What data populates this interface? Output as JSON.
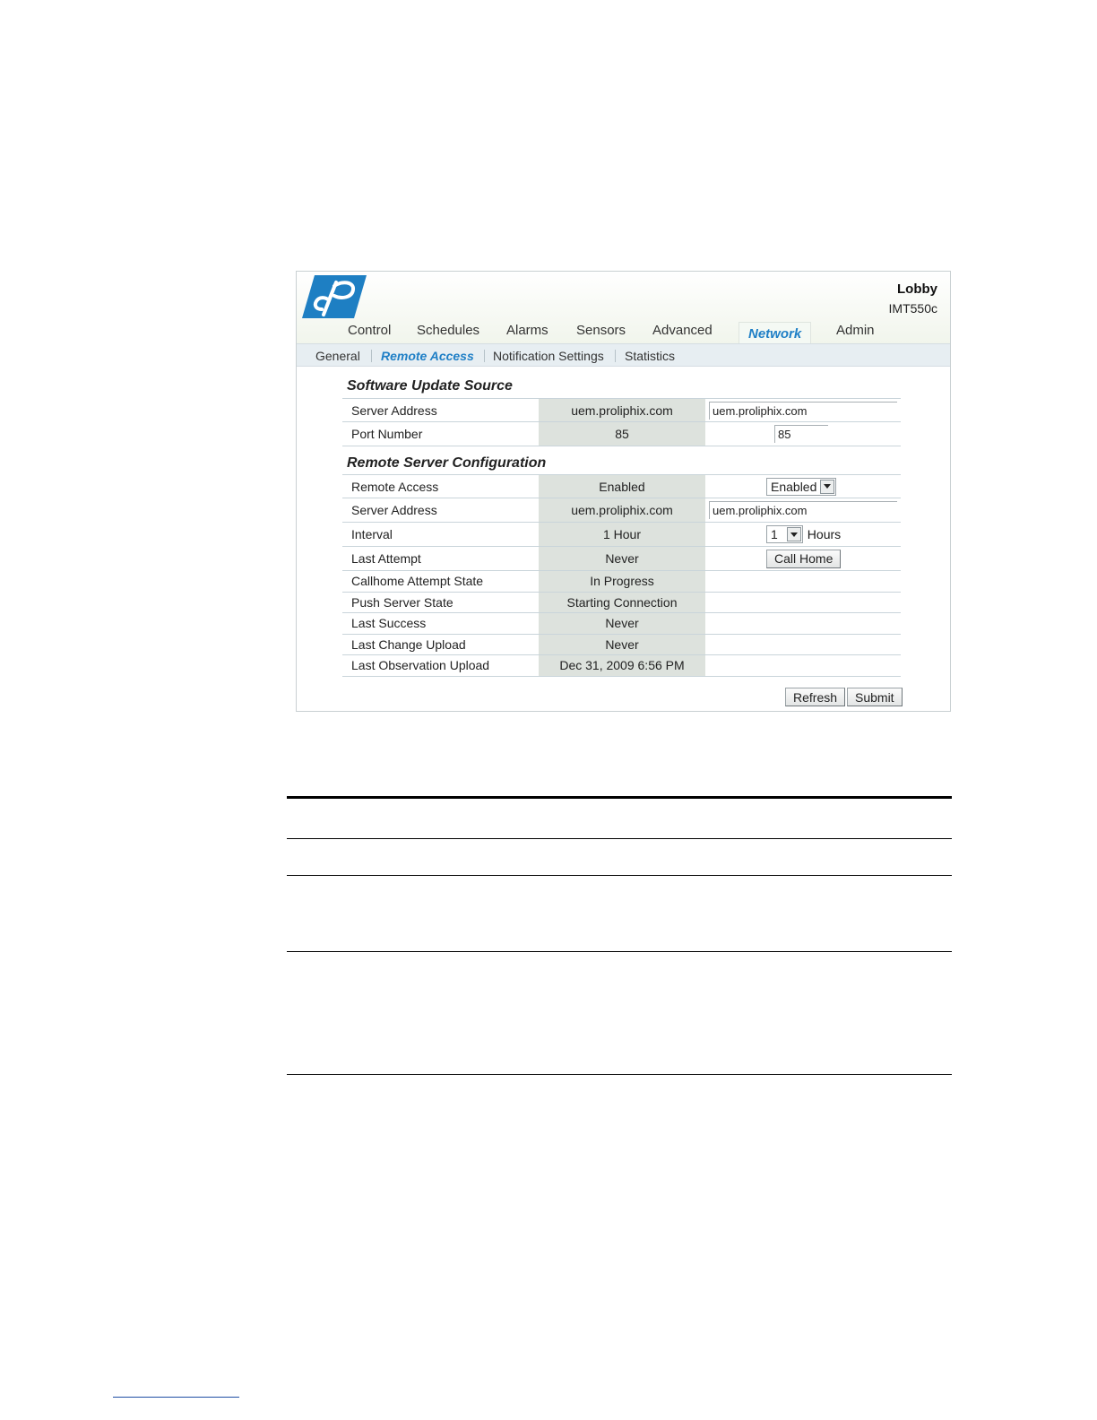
{
  "header": {
    "device_name": "Lobby",
    "device_model": "IMT550c"
  },
  "main_nav": [
    {
      "label": "Control"
    },
    {
      "label": "Schedules"
    },
    {
      "label": "Alarms"
    },
    {
      "label": "Sensors"
    },
    {
      "label": "Advanced"
    },
    {
      "label": "Network",
      "active": true
    },
    {
      "label": "Admin"
    }
  ],
  "sub_nav": [
    {
      "label": "General"
    },
    {
      "label": "Remote Access",
      "active": true
    },
    {
      "label": "Notification Settings"
    },
    {
      "label": "Statistics"
    }
  ],
  "software_update": {
    "title": "Software Update Source",
    "rows": [
      {
        "label": "Server Address",
        "current": "uem.proliphix.com",
        "input_value": "uem.proliphix.com"
      },
      {
        "label": "Port Number",
        "current": "85",
        "input_value": "85"
      }
    ]
  },
  "remote_server": {
    "title": "Remote Server Configuration",
    "remote_access": {
      "label": "Remote Access",
      "current": "Enabled",
      "select_value": "Enabled"
    },
    "server_address": {
      "label": "Server Address",
      "current": "uem.proliphix.com",
      "input_value": "uem.proliphix.com"
    },
    "interval": {
      "label": "Interval",
      "current": "1 Hour",
      "select_value": "1",
      "unit": "Hours"
    },
    "last_attempt": {
      "label": "Last Attempt",
      "current": "Never",
      "button": "Call Home"
    },
    "status_rows": [
      {
        "label": "Callhome Attempt State",
        "current": "In Progress"
      },
      {
        "label": "Push Server State",
        "current": "Starting Connection"
      },
      {
        "label": "Last Success",
        "current": "Never"
      },
      {
        "label": "Last Change Upload",
        "current": "Never"
      },
      {
        "label": "Last Observation Upload",
        "current": "Dec 31, 2009 6:56 PM"
      }
    ]
  },
  "actions": {
    "refresh": "Refresh",
    "submit": "Submit"
  },
  "colors": {
    "accent": "#1f7fc6",
    "logo": "#1e7fc3",
    "current_value_bg": "#dde2dd",
    "subnav_bg": "#e7eef2"
  }
}
